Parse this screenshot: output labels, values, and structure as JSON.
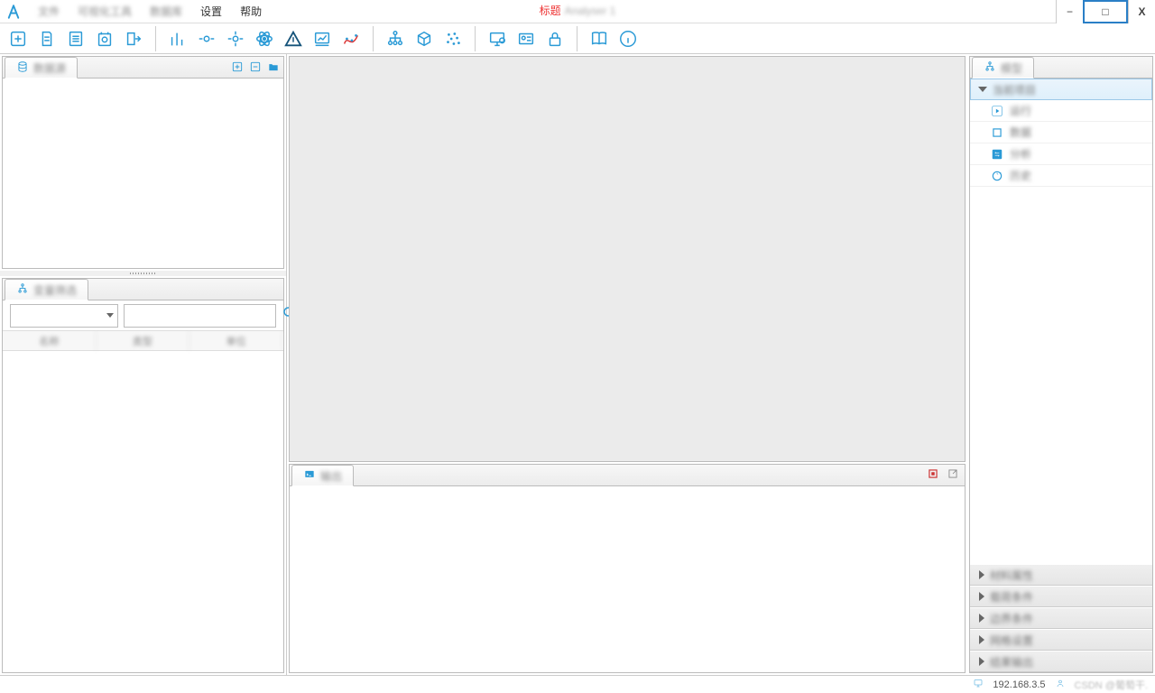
{
  "menubar": {
    "items": [
      "文件",
      "可视化工具",
      "数据库",
      "设置",
      "帮助"
    ]
  },
  "title": {
    "label": "标题",
    "value": "Analyser 1"
  },
  "window_controls": {
    "minimize": "−",
    "restore": "□",
    "close": "X"
  },
  "toolbar_groups": [
    [
      "new",
      "open",
      "list",
      "settings-file",
      "export"
    ],
    [
      "bar-chart",
      "center",
      "target",
      "atom",
      "triangle",
      "regression",
      "curve"
    ],
    [
      "tree",
      "cube",
      "scatter"
    ],
    [
      "monitor",
      "card",
      "lock"
    ],
    [
      "book",
      "info"
    ]
  ],
  "left": {
    "top_tab": "数据源",
    "mid_tab": "变量筛选",
    "grid_cols": [
      "名称",
      "类型",
      "单位"
    ]
  },
  "console": {
    "tab": "输出"
  },
  "right": {
    "tab": "模型",
    "root": "当前项目",
    "children": [
      "运行",
      "数据",
      "分析",
      "历史"
    ],
    "sections": [
      "材料属性",
      "载荷条件",
      "边界条件",
      "网格设置",
      "结果输出"
    ]
  },
  "status": {
    "ip": "192.168.3.5",
    "watermark": "CSDN @葡萄干."
  }
}
